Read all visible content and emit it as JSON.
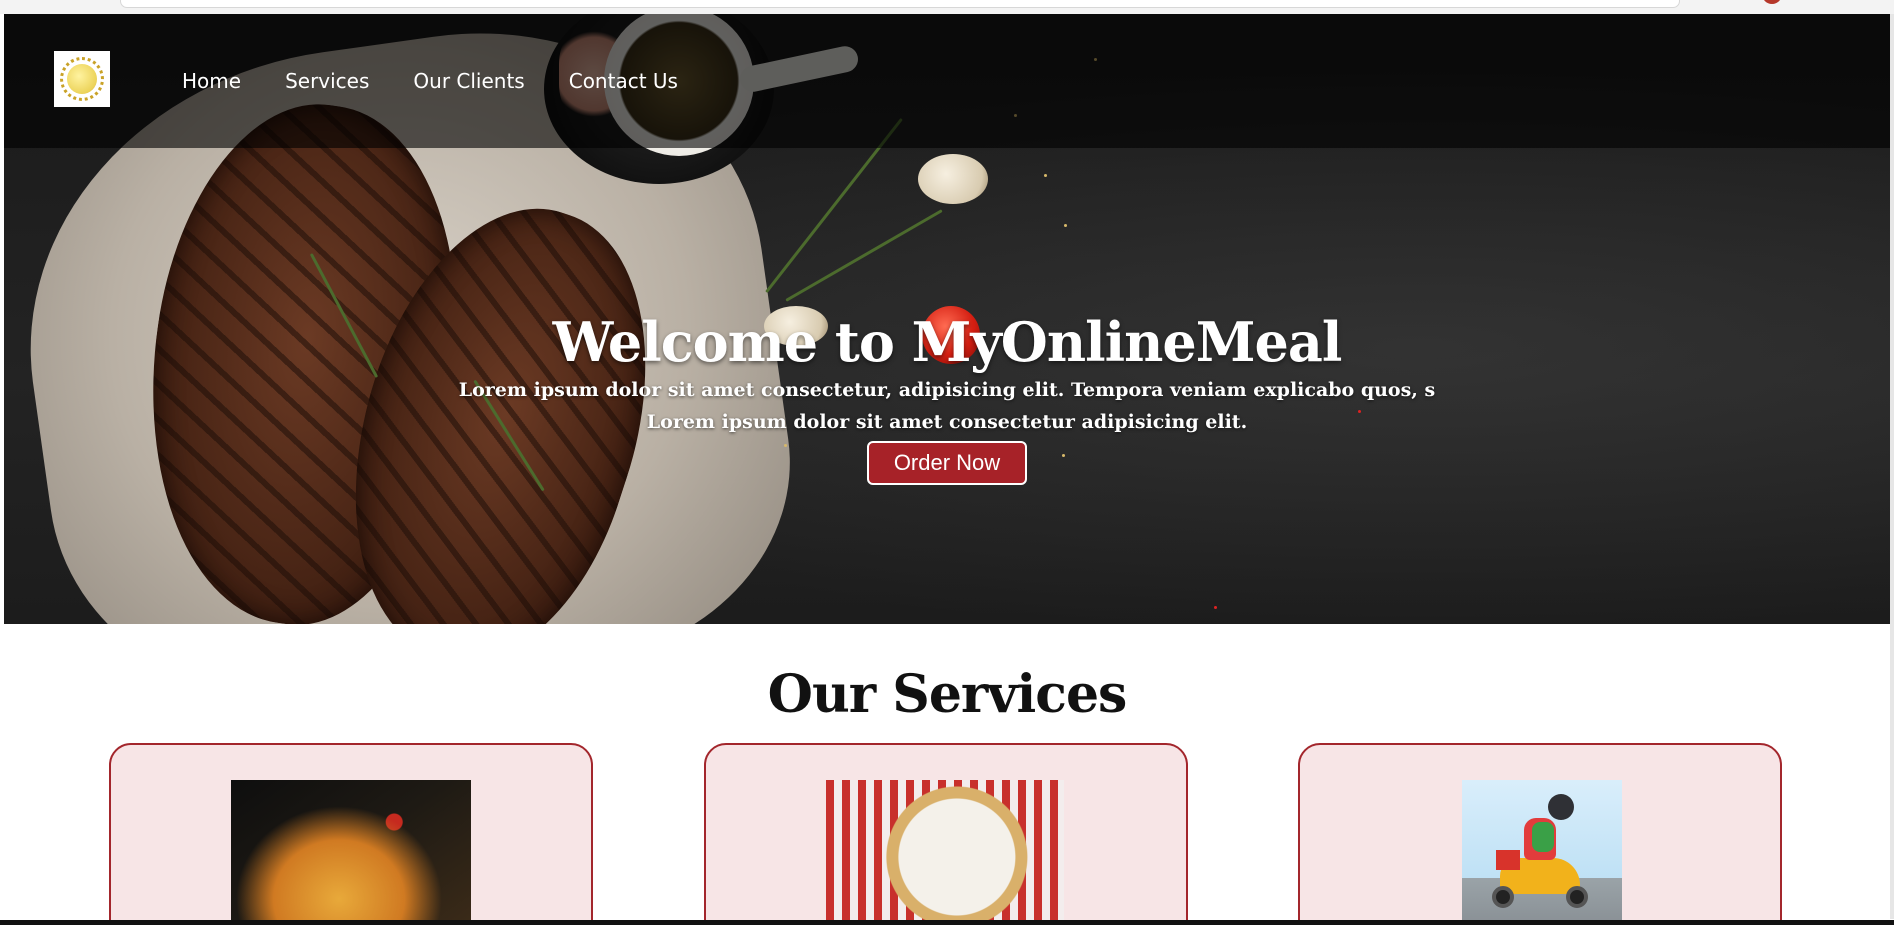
{
  "nav": {
    "links": [
      "Home",
      "Services",
      "Our Clients",
      "Contact Us"
    ]
  },
  "hero": {
    "title": "Welcome to MyOnlineMeal",
    "line1": "Lorem ipsum dolor sit amet consectetur, adipisicing elit. Tempora veniam explicabo quos, s",
    "line2": "Lorem ipsum dolor sit amet consectetur adipisicing elit.",
    "order_button": "Order Now"
  },
  "services": {
    "title": "Our Services"
  },
  "colors": {
    "accent": "#a72228",
    "card_bg": "#f7e5e6",
    "card_border": "#a3262c"
  }
}
